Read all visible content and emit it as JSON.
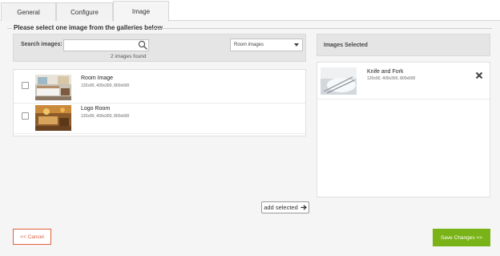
{
  "tabs": [
    {
      "label": "General",
      "active": false
    },
    {
      "label": "Configure",
      "active": false
    },
    {
      "label": "Image",
      "active": true
    }
  ],
  "heading": "Please select one image from the galleries below",
  "search": {
    "label": "Search images:",
    "value": "",
    "placeholder": "",
    "found_text": "2 images found",
    "icon": "search-icon"
  },
  "gallery_select": {
    "selected": "Room images",
    "icon": "chevron-down-icon"
  },
  "results": [
    {
      "title": "Room Image",
      "sizes": "120x90, 400x300, 800x600",
      "checked": false
    },
    {
      "title": "Logo Room",
      "sizes": "120x90, 400x300, 800x600",
      "checked": false
    }
  ],
  "selected_panel": {
    "header": "Images Selected",
    "items": [
      {
        "title": "Knife and Fork",
        "sizes": "120x90, 400x300, 800x600",
        "remove_icon": "close-icon"
      }
    ]
  },
  "add_selected_label": "add selected",
  "cancel_label": "<< Cancel",
  "save_label": "Save Changes >>",
  "colors": {
    "accent_green": "#7ab317",
    "cancel_red": "#e0603c"
  }
}
